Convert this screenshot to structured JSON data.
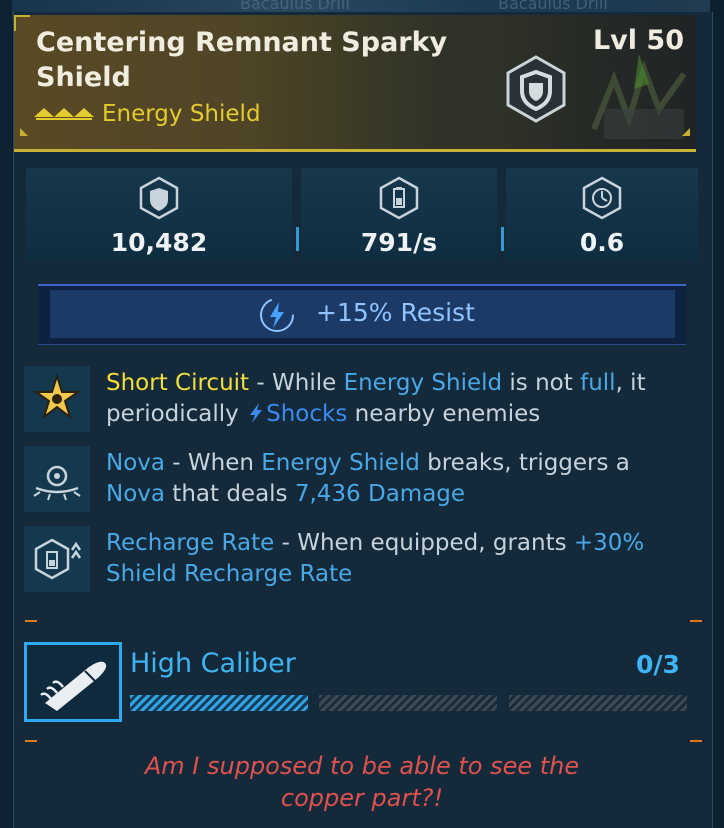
{
  "background": {
    "ghost_left": "Bacaulus Drill",
    "ghost_right": "Bacaulus Drill"
  },
  "header": {
    "item_name": "Centering Remnant Sparky Shield",
    "level": "Lvl 50",
    "item_type": "Energy Shield",
    "rarity_icon": "chevrons-icon",
    "badge_icon": "shield-icon"
  },
  "stats": [
    {
      "icon": "shield-icon",
      "value": "10,482"
    },
    {
      "icon": "battery-recharge-icon",
      "value": "791/s"
    },
    {
      "icon": "recharge-delay-icon",
      "value": "0.6"
    }
  ],
  "resist": {
    "icon": "lightning-icon",
    "text": "+15% Resist"
  },
  "perks": [
    {
      "icon": "star-burst-icon",
      "name": "Short Circuit",
      "parts": [
        " - While ",
        "Energy Shield",
        " is not ",
        "full",
        ", it periodically ",
        "Shocks",
        " nearby enemies"
      ]
    },
    {
      "icon": "nova-icon",
      "name": "Nova",
      "parts": [
        " - When ",
        "Energy Shield",
        " breaks, triggers a ",
        "Nova",
        " that deals ",
        "7,436 Damage"
      ]
    },
    {
      "icon": "recharge-boost-icon",
      "name": "Recharge Rate",
      "parts": [
        " - When equipped, grants ",
        "+30%",
        "Shield Recharge Rate"
      ]
    }
  ],
  "augment": {
    "icon": "bullet-icon",
    "label": "High Caliber",
    "count": "0/3",
    "segments_filled": 1,
    "segments_total": 3
  },
  "flavor": {
    "line1": "Am I supposed to be able to see the",
    "line2": "copper part?!"
  },
  "colors": {
    "gold": "#e4cc2e",
    "highlight_blue": "#48a8e8",
    "augment_blue": "#3eb4f4",
    "flavor_red": "#e0514e"
  }
}
